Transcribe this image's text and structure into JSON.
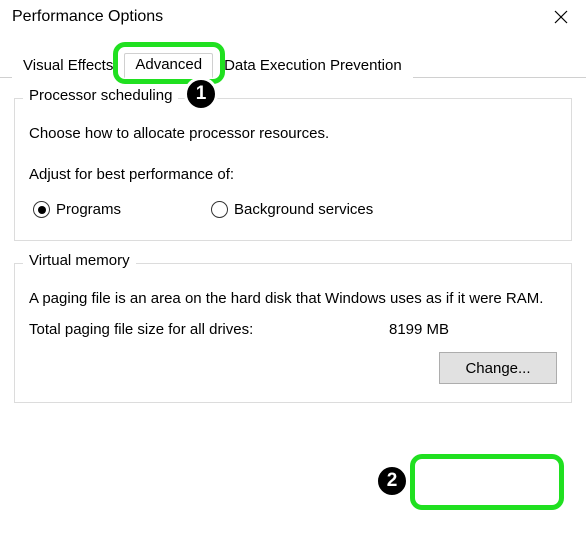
{
  "window": {
    "title": "Performance Options"
  },
  "tabs": {
    "visual_effects": "Visual Effects",
    "advanced": "Advanced",
    "dep": "Data Execution Prevention"
  },
  "processor": {
    "group_title": "Processor scheduling",
    "desc": "Choose how to allocate processor resources.",
    "adjust_label": "Adjust for best performance of:",
    "option_programs": "Programs",
    "option_background": "Background services"
  },
  "vm": {
    "group_title": "Virtual memory",
    "desc": "A paging file is an area on the hard disk that Windows uses as if it were RAM.",
    "total_label": "Total paging file size for all drives:",
    "total_value": "8199 MB",
    "change_btn": "Change..."
  },
  "callouts": {
    "one": "1",
    "two": "2"
  }
}
